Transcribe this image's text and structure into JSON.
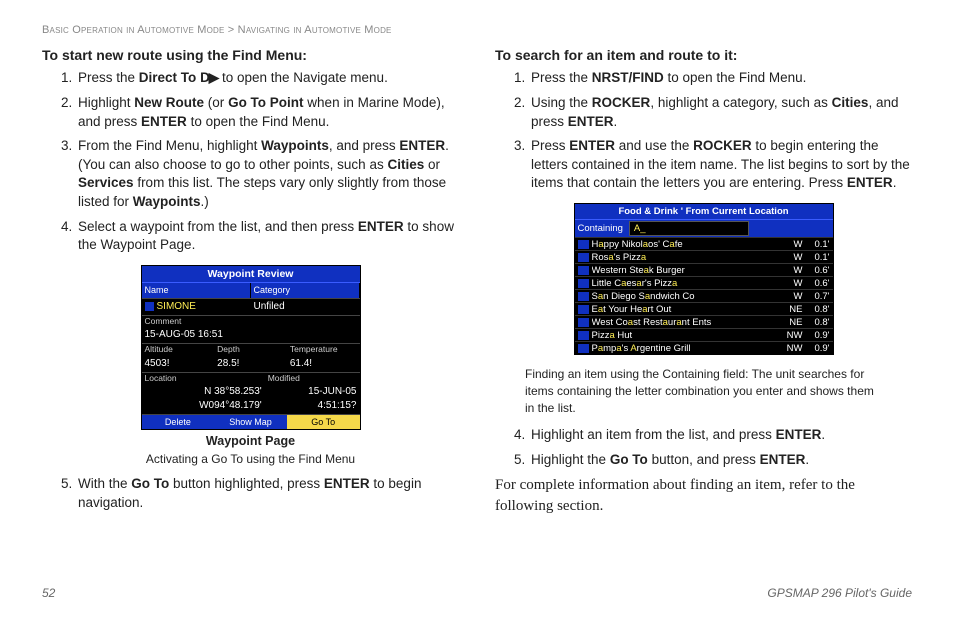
{
  "header": {
    "breadcrumb1": "Basic Operation in Automotive Mode",
    "sep": " > ",
    "breadcrumb2": "Navigating in Automotive Mode"
  },
  "left": {
    "title": "To start new route using the Find Menu:",
    "step1a": "Press the ",
    "step1b": "Direct To",
    "step1c": " to open the Navigate menu.",
    "step2a": "Highlight ",
    "step2b": "New Route",
    "step2c": " (or ",
    "step2d": "Go To Point",
    "step2e": " when in Marine Mode), and press ",
    "step2f": "ENTER",
    "step2g": " to open the Find Menu.",
    "step3a": "From the Find Menu, highlight ",
    "step3b": "Waypoints",
    "step3c": ", and press ",
    "step3d": "ENTER",
    "step3e": ". (You can also choose to go to other points, such as ",
    "step3f": "Cities",
    "step3g": " or ",
    "step3h": "Services",
    "step3i": " from this list. The steps vary only slightly from those listed for ",
    "step3j": "Waypoints",
    "step3k": ".)",
    "step4a": "Select a waypoint from the list, and then press ",
    "step4b": "ENTER",
    "step4c": " to show the Waypoint Page.",
    "step5a": "With the ",
    "step5b": "Go To",
    "step5c": " button highlighted, press ",
    "step5d": "ENTER",
    "step5e": " to begin navigation.",
    "fig_caption": "Waypoint Page",
    "fig_sub": "Activating a Go To using the Find Menu"
  },
  "gpsA": {
    "title": "Waypoint Review",
    "h_name": "Name",
    "h_cat": "Category",
    "name": "SIMONE",
    "cat": "Unfiled",
    "l_comment": "Comment",
    "comment": "15-AUG-05 16:51",
    "l_alt": "Altitude",
    "l_depth": "Depth",
    "l_temp": "Temperature",
    "alt": "4503!",
    "depth": "28.5!",
    "temp": "61.4!",
    "l_loc": "Location",
    "l_mod": "Modified",
    "loc1": "N 38°58.253'",
    "loc2": "W094°48.179'",
    "mod1": "15-JUN-05",
    "mod2": "4:51:15?",
    "btn1": "Delete",
    "btn2": "Show Map",
    "btn3": "Go To"
  },
  "right": {
    "title": "To search for an item and route to it:",
    "step1a": "Press the ",
    "step1b": "NRST/FIND",
    "step1c": " to open the Find Menu.",
    "step2a": "Using the ",
    "step2b": "ROCKER",
    "step2c": ", highlight a category, such as ",
    "step2d": "Cities",
    "step2e": ", and press ",
    "step2f": "ENTER",
    "step2g": ".",
    "step3a": "Press ",
    "step3b": "ENTER",
    "step3c": " and use the ",
    "step3d": "ROCKER",
    "step3e": " to begin entering the letters contained in the item name. The list begins to sort by the items that contain the letters you are entering. Press ",
    "step3f": "ENTER",
    "step3g": ".",
    "note": "Finding an item using the Containing field: The unit searches for items containing the letter combination you enter and shows them in the list.",
    "step4a": "Highlight an item from the list, and press ",
    "step4b": "ENTER",
    "step4c": ".",
    "step5a": "Highlight the ",
    "step5b": "Go To",
    "step5c": " button, and press ",
    "step5d": "ENTER",
    "step5e": ".",
    "serif": "For complete information about finding an item, refer to the following section."
  },
  "gpsB": {
    "title": "Food & Drink ' From Current Location",
    "contain_lbl": "Containing",
    "contain_val": "A_",
    "rows": [
      {
        "n1": "H",
        "h": "a",
        "n2": "ppy Nikol",
        "h2": "a",
        "n3": "os' C",
        "h3": "a",
        "n4": "fe",
        "dir": "W",
        "dist": "0.1'"
      },
      {
        "n1": "Ros",
        "h": "a",
        "n2": "'s Pizz",
        "h2": "a",
        "n3": "",
        "h3": "",
        "n4": "",
        "dir": "W",
        "dist": "0.1'"
      },
      {
        "n1": "Western Ste",
        "h": "a",
        "n2": "k Burger",
        "h2": "",
        "n3": "",
        "h3": "",
        "n4": "",
        "dir": "W",
        "dist": "0.6'"
      },
      {
        "n1": "Little C",
        "h": "a",
        "n2": "es",
        "h2": "a",
        "n3": "r's Pizz",
        "h3": "a",
        "n4": "",
        "dir": "W",
        "dist": "0.6'"
      },
      {
        "n1": "S",
        "h": "a",
        "n2": "n Diego S",
        "h2": "a",
        "n3": "ndwich Co",
        "h3": "",
        "n4": "",
        "dir": "W",
        "dist": "0.7'"
      },
      {
        "n1": "E",
        "h": "a",
        "n2": "t Your He",
        "h2": "a",
        "n3": "rt Out",
        "h3": "",
        "n4": "",
        "dir": "NE",
        "dist": "0.8'"
      },
      {
        "n1": "West Co",
        "h": "a",
        "n2": "st Rest",
        "h2": "a",
        "n3": "ur",
        "h3": "a",
        "n4": "nt Ents",
        "dir": "NE",
        "dist": "0.8'"
      },
      {
        "n1": "Pizz",
        "h": "a",
        "n2": " Hut",
        "h2": "",
        "n3": "",
        "h3": "",
        "n4": "",
        "dir": "NW",
        "dist": "0.9'"
      },
      {
        "n1": "P",
        "h": "a",
        "n2": "mp",
        "h2": "a",
        "n3": "'s ",
        "h3": "A",
        "n4": "rgentine Grill",
        "dir": "NW",
        "dist": "0.9'"
      }
    ]
  },
  "footer": {
    "page": "52",
    "guide": "GPSMAP 296 Pilot's Guide"
  }
}
